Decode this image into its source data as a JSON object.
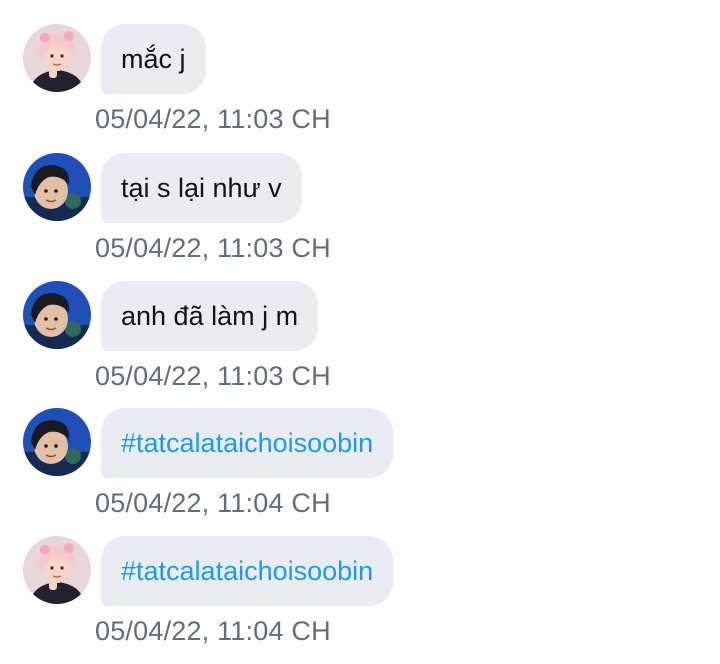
{
  "colors": {
    "bubble_bg": "#e9edf1",
    "text": "#111418",
    "hashtag": "#1d9bf0",
    "timestamp": "#5f6f7c"
  },
  "messages": [
    {
      "avatar": "avatar-pink-hair-icon",
      "text": "mắc j",
      "time": "05/04/22, 11:03 CH"
    },
    {
      "avatar": "avatar-dark-hair-icon",
      "text": "tại s lại như v",
      "time": "05/04/22, 11:03 CH"
    },
    {
      "avatar": "avatar-dark-hair-icon",
      "text": "anh đã làm j m",
      "time": "05/04/22, 11:03 CH"
    },
    {
      "avatar": "avatar-dark-hair-icon",
      "text": "#tatcalataichoisoobin",
      "time": "05/04/22, 11:04 CH"
    },
    {
      "avatar": "avatar-pink-hair-icon",
      "text": "#tatcalataichoisoobin",
      "time": "05/04/22, 11:04 CH"
    }
  ]
}
